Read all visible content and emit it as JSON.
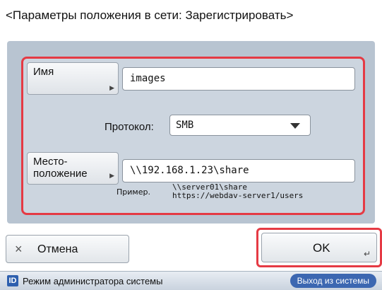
{
  "header": {
    "title": "<Параметры положения в сети: Зарегистрировать>"
  },
  "form": {
    "name_button": "Имя",
    "name_value": "images",
    "protocol_label": "Протокол:",
    "protocol_value": "SMB",
    "location_button_line1": "Место-",
    "location_button_line2": "положение",
    "location_value": "\\\\192.168.1.23\\share",
    "example_label": "Пример.",
    "example_line1": "\\\\server01\\share",
    "example_line2": "https://webdav-server1/users"
  },
  "footer": {
    "cancel_icon": "close-icon",
    "cancel_label": "Отмена",
    "ok_label": "OK"
  },
  "status": {
    "mode_badge": "ID",
    "mode_text": "Режим администратора системы",
    "logout_label": "Выход из системы"
  },
  "colors": {
    "highlight": "#e53a44",
    "panel": "#b8c4d1",
    "status_button": "#3c67b1"
  }
}
